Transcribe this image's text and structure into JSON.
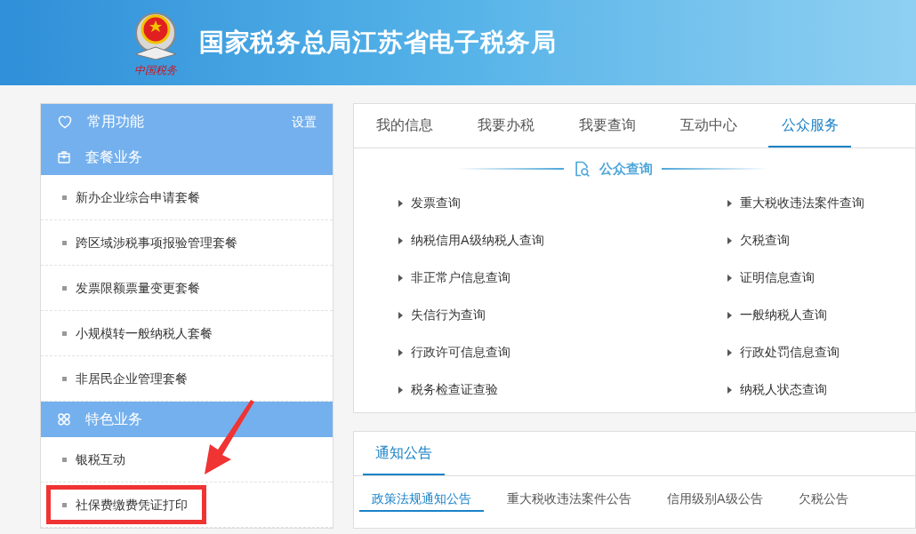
{
  "header": {
    "logo_text": "中国税务",
    "title": "国家税务总局江苏省电子税务局"
  },
  "sidebar": {
    "sections": [
      {
        "kind": "favorites",
        "title": "常用功能",
        "action": "设置"
      },
      {
        "kind": "package",
        "title": "套餐业务",
        "items": [
          {
            "label": "新办企业综合申请套餐",
            "highlighted": false
          },
          {
            "label": "跨区域涉税事项报验管理套餐",
            "highlighted": false
          },
          {
            "label": "发票限额票量变更套餐",
            "highlighted": false
          },
          {
            "label": "小规模转一般纳税人套餐",
            "highlighted": false
          },
          {
            "label": "非居民企业管理套餐",
            "highlighted": false
          }
        ]
      },
      {
        "kind": "featured",
        "title": "特色业务",
        "items": [
          {
            "label": "银税互动",
            "highlighted": false
          },
          {
            "label": "社保费缴费凭证打印",
            "highlighted": true
          }
        ]
      }
    ]
  },
  "main_tabs": [
    {
      "label": "我的信息",
      "selected": false
    },
    {
      "label": "我要办税",
      "selected": false
    },
    {
      "label": "我要查询",
      "selected": false
    },
    {
      "label": "互动中心",
      "selected": false
    },
    {
      "label": "公众服务",
      "selected": true
    }
  ],
  "query_section": {
    "title": "公众查询",
    "links": [
      "发票查询",
      "重大税收违法案件查询",
      "纳税信用A级纳税人查询",
      "欠税查询",
      "非正常户信息查询",
      "证明信息查询",
      "失信行为查询",
      "一般纳税人查询",
      "行政许可信息查询",
      "行政处罚信息查询",
      "税务检查证查验",
      "纳税人状态查询"
    ]
  },
  "notice": {
    "tabs": [
      {
        "label": "通知公告",
        "selected": true
      }
    ],
    "subtabs": [
      {
        "label": "政策法规通知公告",
        "selected": true
      },
      {
        "label": "重大税收违法案件公告",
        "selected": false
      },
      {
        "label": "信用级别A级公告",
        "selected": false
      },
      {
        "label": "欠税公告",
        "selected": false
      }
    ]
  }
}
